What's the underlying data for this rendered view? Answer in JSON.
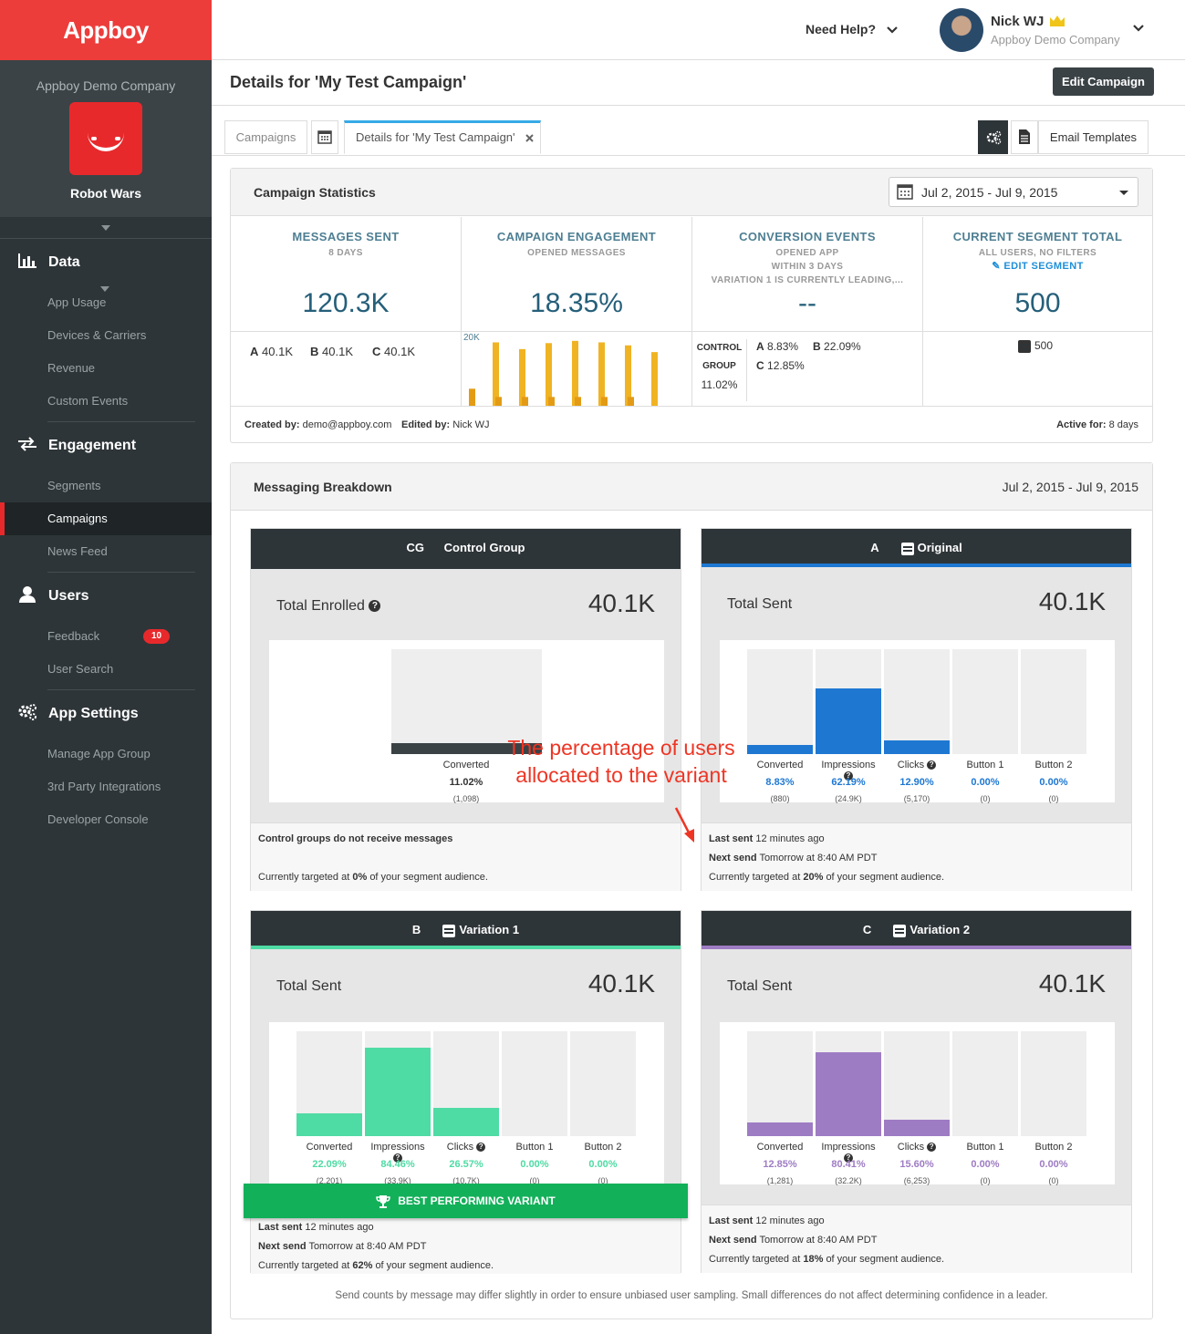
{
  "brand": "Appboy",
  "sidebar": {
    "company": "Appboy Demo Company",
    "app_name": "Robot Wars",
    "sections": [
      {
        "title": "Data",
        "items": [
          "App Usage",
          "Devices & Carriers",
          "Revenue",
          "Custom Events"
        ]
      },
      {
        "title": "Engagement",
        "items": [
          "Segments",
          "Campaigns",
          "News Feed"
        ]
      },
      {
        "title": "Users",
        "items": [
          "Feedback",
          "User Search"
        ]
      },
      {
        "title": "App Settings",
        "items": [
          "Manage App Group",
          "3rd Party Integrations",
          "Developer Console"
        ]
      }
    ],
    "feedback_badge": "10"
  },
  "topbar": {
    "help": "Need Help?",
    "user_name": "Nick WJ",
    "user_company": "Appboy Demo Company"
  },
  "page": {
    "title": "Details for 'My Test Campaign'",
    "edit_button": "Edit Campaign"
  },
  "tabs": {
    "campaigns": "Campaigns",
    "details": "Details for 'My Test Campaign'",
    "email_templates": "Email Templates"
  },
  "stats": {
    "title": "Campaign Statistics",
    "date_range": "Jul 2, 2015 - Jul 9, 2015",
    "messages_sent": {
      "title": "MESSAGES SENT",
      "sub": "8 DAYS",
      "value": "120.3K",
      "a": "40.1K",
      "b": "40.1K",
      "c": "40.1K"
    },
    "engagement": {
      "title": "CAMPAIGN ENGAGEMENT",
      "sub": "OPENED MESSAGES",
      "value": "18.35%",
      "axis": "20K"
    },
    "conversion": {
      "title": "CONVERSION EVENTS",
      "sub1": "OPENED APP",
      "sub2": "WITHIN 3 DAYS",
      "sub3": "VARIATION 1 IS CURRENTLY LEADING,...",
      "value": "--",
      "control_label1": "CONTROL",
      "control_label2": "GROUP",
      "control_value": "11.02%",
      "a": "8.83%",
      "b": "22.09%",
      "c": "12.85%"
    },
    "segment": {
      "title": "CURRENT SEGMENT TOTAL",
      "sub": "ALL USERS, NO FILTERS",
      "edit": "EDIT SEGMENT",
      "value": "500",
      "count": "500"
    },
    "created_label": "Created by:",
    "created_by": "demo@appboy.com",
    "edited_label": "Edited by:",
    "edited_by": "Nick WJ",
    "active_label": "Active for:",
    "active_for": "8 days"
  },
  "breakdown": {
    "title": "Messaging Breakdown",
    "date_range": "Jul 2, 2015 - Jul 9, 2015",
    "footnote": "Send counts by message may differ slightly in order to ensure unbiased user sampling. Small differences do not affect determining confidence in a leader.",
    "annotation": {
      "line1": "The percentage of users",
      "line2": "allocated to the variant"
    },
    "best_banner": "BEST PERFORMING VARIANT",
    "control": {
      "letter": "CG",
      "name": "Control Group",
      "total_label": "Total Enrolled",
      "total": "40.1K",
      "converted_label": "Converted",
      "converted_pct": "11.02%",
      "converted_count": "(1,098)",
      "no_msg": "Control groups do not receive messages",
      "target_prefix": "Currently targeted at",
      "target": "0%",
      "target_suffix": "of your segment audience."
    },
    "variants": [
      {
        "letter": "A",
        "name": "Original",
        "total_label": "Total Sent",
        "total": "40.1K",
        "color": "#1e78d2",
        "metrics": [
          {
            "label": "Converted",
            "pct": "8.83%",
            "count": "(880)",
            "level": 0.0883
          },
          {
            "label": "Impressions",
            "pct": "62.19%",
            "count": "(24.9K)",
            "level": 0.6219
          },
          {
            "label": "Clicks",
            "pct": "12.90%",
            "count": "(5,170)",
            "level": 0.129
          },
          {
            "label": "Button 1",
            "pct": "0.00%",
            "count": "(0)",
            "level": 0
          },
          {
            "label": "Button 2",
            "pct": "0.00%",
            "count": "(0)",
            "level": 0
          }
        ],
        "last_label": "Last sent",
        "last": "12 minutes ago",
        "next_label": "Next send",
        "next": "Tomorrow at 8:40 AM PDT",
        "target_prefix": "Currently targeted at",
        "target": "20%",
        "target_suffix": "of your segment audience."
      },
      {
        "letter": "B",
        "name": "Variation 1",
        "total_label": "Total Sent",
        "total": "40.1K",
        "color": "#4fdba4",
        "metrics": [
          {
            "label": "Converted",
            "pct": "22.09%",
            "count": "(2,201)",
            "level": 0.2209
          },
          {
            "label": "Impressions",
            "pct": "84.46%",
            "count": "(33.9K)",
            "level": 0.8446
          },
          {
            "label": "Clicks",
            "pct": "26.57%",
            "count": "(10.7K)",
            "level": 0.2657
          },
          {
            "label": "Button 1",
            "pct": "0.00%",
            "count": "(0)",
            "level": 0
          },
          {
            "label": "Button 2",
            "pct": "0.00%",
            "count": "(0)",
            "level": 0
          }
        ],
        "last_label": "Last sent",
        "last": "12 minutes ago",
        "next_label": "Next send",
        "next": "Tomorrow at 8:40 AM PDT",
        "target_prefix": "Currently targeted at",
        "target": "62%",
        "target_suffix": "of your segment audience."
      },
      {
        "letter": "C",
        "name": "Variation 2",
        "total_label": "Total Sent",
        "total": "40.1K",
        "color": "#9e7cc4",
        "metrics": [
          {
            "label": "Converted",
            "pct": "12.85%",
            "count": "(1,281)",
            "level": 0.1285
          },
          {
            "label": "Impressions",
            "pct": "80.41%",
            "count": "(32.2K)",
            "level": 0.8041
          },
          {
            "label": "Clicks",
            "pct": "15.60%",
            "count": "(6,253)",
            "level": 0.156
          },
          {
            "label": "Button 1",
            "pct": "0.00%",
            "count": "(0)",
            "level": 0
          },
          {
            "label": "Button 2",
            "pct": "0.00%",
            "count": "(0)",
            "level": 0
          }
        ],
        "last_label": "Last sent",
        "last": "12 minutes ago",
        "next_label": "Next send",
        "next": "Tomorrow at 8:40 AM PDT",
        "target_prefix": "Currently targeted at",
        "target": "18%",
        "target_suffix": "of your segment audience."
      }
    ]
  },
  "colors": {
    "brand_red": "#ec3d3b",
    "sidebar": "#2e3538",
    "engagement_orange": "#f0b323",
    "best_green": "#13b05a"
  }
}
